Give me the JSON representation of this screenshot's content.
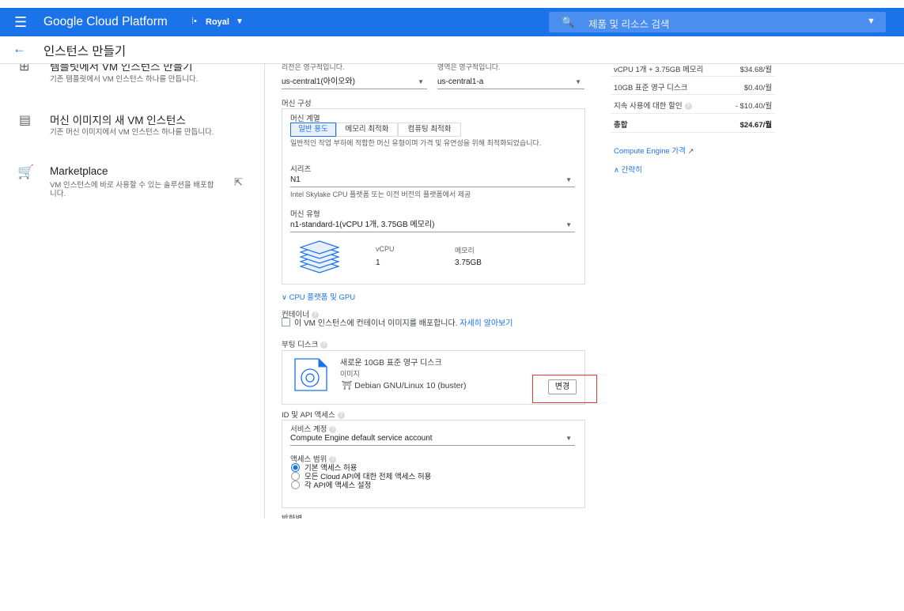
{
  "header": {
    "brand": "Google Cloud Platform",
    "project": "Royal",
    "search_placeholder": "제품 및 리소스 검색"
  },
  "titlebar": {
    "title": "인스턴스 만들기"
  },
  "left": {
    "items": [
      {
        "title": "템플릿에서 VM 인스턴스 만들기",
        "desc": "기존 템플릿에서 VM 인스턴스 하나를 만듭니다."
      },
      {
        "title": "머신 이미지의 새 VM 인스턴스",
        "desc": "기존 머신 이미지에서 VM 인스턴스 하나를 만듭니다."
      },
      {
        "title": "Marketplace",
        "desc": "VM 인스턴스에 바로 사용할 수 있는 솔루션을 배포합니다."
      }
    ]
  },
  "form": {
    "region_hint": "리전은 영구적입니다.",
    "zone_hint": "영역은 영구적입니다.",
    "region_value": "us-central1(아이오와)",
    "zone_value": "us-central1-a",
    "machine_config_label": "머신 구성",
    "machine_family_label": "머신 계열",
    "tabs": [
      "일반 용도",
      "메모리 최적화",
      "컴퓨팅 최적화"
    ],
    "family_desc": "일반적인 작업 부하에 적합한 머신 유형이며 가격 및 유연성을 위해 최적화되었습니다.",
    "series_label": "시리즈",
    "series_value": "N1",
    "series_desc": "Intel Skylake CPU 플랫폼 또는 이전 버전의 플랫폼에서 제공",
    "machine_type_label": "머신 유형",
    "machine_type_value": "n1-standard-1(vCPU 1개, 3.75GB 메모리)",
    "vcpu_label": "vCPU",
    "vcpu_value": "1",
    "memory_label": "메모리",
    "memory_value": "3.75GB",
    "cpu_platform_link": "CPU 플랫폼 및 GPU",
    "container_label": "컨테이너",
    "container_check_text": "이 VM 인스턴스에 컨테이너 이미지를 배포합니다.",
    "container_learn_more": "자세히 알아보기",
    "boot_disk_label": "부팅 디스크",
    "boot_disk_title": "새로운 10GB 표준 영구 디스크",
    "boot_disk_image_label": "이미지",
    "boot_disk_image": "Debian GNU/Linux 10 (buster)",
    "change_button": "변경",
    "identity_label": "ID 및 API 액세스",
    "service_account_label": "서비스 계정",
    "service_account_value": "Compute Engine default service account",
    "access_scope_label": "액세스 범위",
    "access_options": [
      "기본 액세스 허용",
      "모든 Cloud API에 대한 전체 액세스 허용",
      "각 API에 액세스 설정"
    ],
    "firewall_label": "방화벽"
  },
  "summary": {
    "rows": [
      {
        "label": "vCPU 1개 + 3.75GB 메모리",
        "value": "$34.68/월"
      },
      {
        "label": "10GB 표준 영구 디스크",
        "value": "$0.40/월"
      },
      {
        "label": "지속 사용에 대한 할인",
        "value": "- $10.40/월"
      }
    ],
    "total_label": "총합",
    "total_value": "$24.67/월",
    "pricing_link": "Compute Engine 가격",
    "collapse_link": "간략히"
  },
  "colors": {
    "brand_blue": "#1a73e8",
    "highlight_red": "#e53935"
  }
}
